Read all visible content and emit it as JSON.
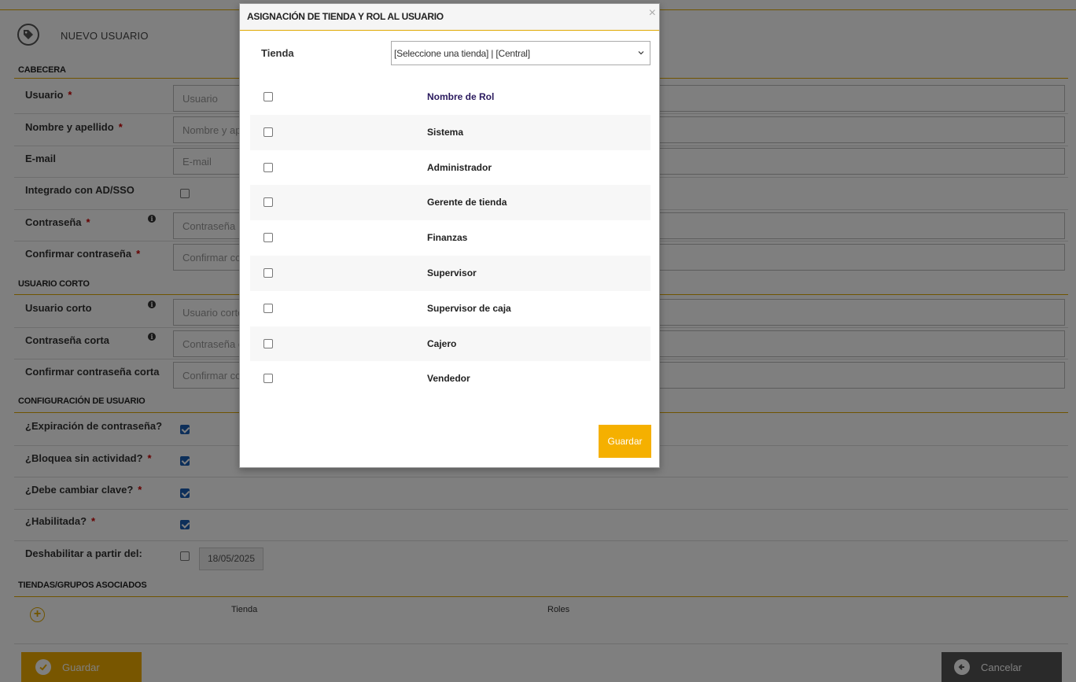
{
  "page": {
    "title": "NUEVO USUARIO",
    "sections": {
      "header": "CABECERA",
      "short_user": "USUARIO CORTO",
      "user_config": "CONFIGURACIÓN DE USUARIO",
      "stores": "TIENDAS/GRUPOS ASOCIADOS"
    },
    "fields": {
      "usuario": {
        "label": "Usuario",
        "placeholder": "Usuario"
      },
      "nombre": {
        "label": "Nombre y apellido",
        "placeholder": "Nombre y apellido"
      },
      "email": {
        "label": "E-mail",
        "placeholder": "E-mail"
      },
      "integrado": {
        "label": "Integrado con AD/SSO"
      },
      "contrasena": {
        "label": "Contraseña",
        "placeholder": "Contraseña"
      },
      "confirmar": {
        "label": "Confirmar contraseña",
        "placeholder": "Confirmar contraseña"
      },
      "usuario_corto": {
        "label": "Usuario corto",
        "placeholder": "Usuario corto"
      },
      "contrasena_corta": {
        "label": "Contraseña corta",
        "placeholder": "Contraseña corta"
      },
      "confirmar_corta": {
        "label": "Confirmar contraseña corta",
        "placeholder": "Confirmar contraseña corta"
      },
      "expiracion": {
        "label": "¿Expiración de contraseña?"
      },
      "bloquea": {
        "label": "¿Bloquea sin actividad?"
      },
      "cambiar": {
        "label": "¿Debe cambiar clave?"
      },
      "habilitada": {
        "label": "¿Habilitada?"
      },
      "deshabilitar": {
        "label": "Deshabilitar a partir del:",
        "date": "18/05/2025"
      }
    },
    "required_mark": "*",
    "table": {
      "col_store": "Tienda",
      "col_roles": "Roles"
    },
    "buttons": {
      "save": "Guardar",
      "cancel": "Cancelar"
    }
  },
  "modal": {
    "title": "ASIGNACIÓN DE TIENDA Y ROL AL USUARIO",
    "close": "×",
    "store_label": "Tienda",
    "store_select_value": "[Seleccione una tienda] | [Central]",
    "role_header": "Nombre de Rol",
    "roles": [
      "Sistema",
      "Administrador",
      "Gerente de tienda",
      "Finanzas",
      "Supervisor",
      "Supervisor de caja",
      "Cajero",
      "Vendedor"
    ],
    "save": "Guardar"
  },
  "colors": {
    "accent": "#e0a800",
    "save_button": "#f0ad00",
    "cancel_button": "#555555",
    "checkbox_checked": "#1a5fb4"
  }
}
